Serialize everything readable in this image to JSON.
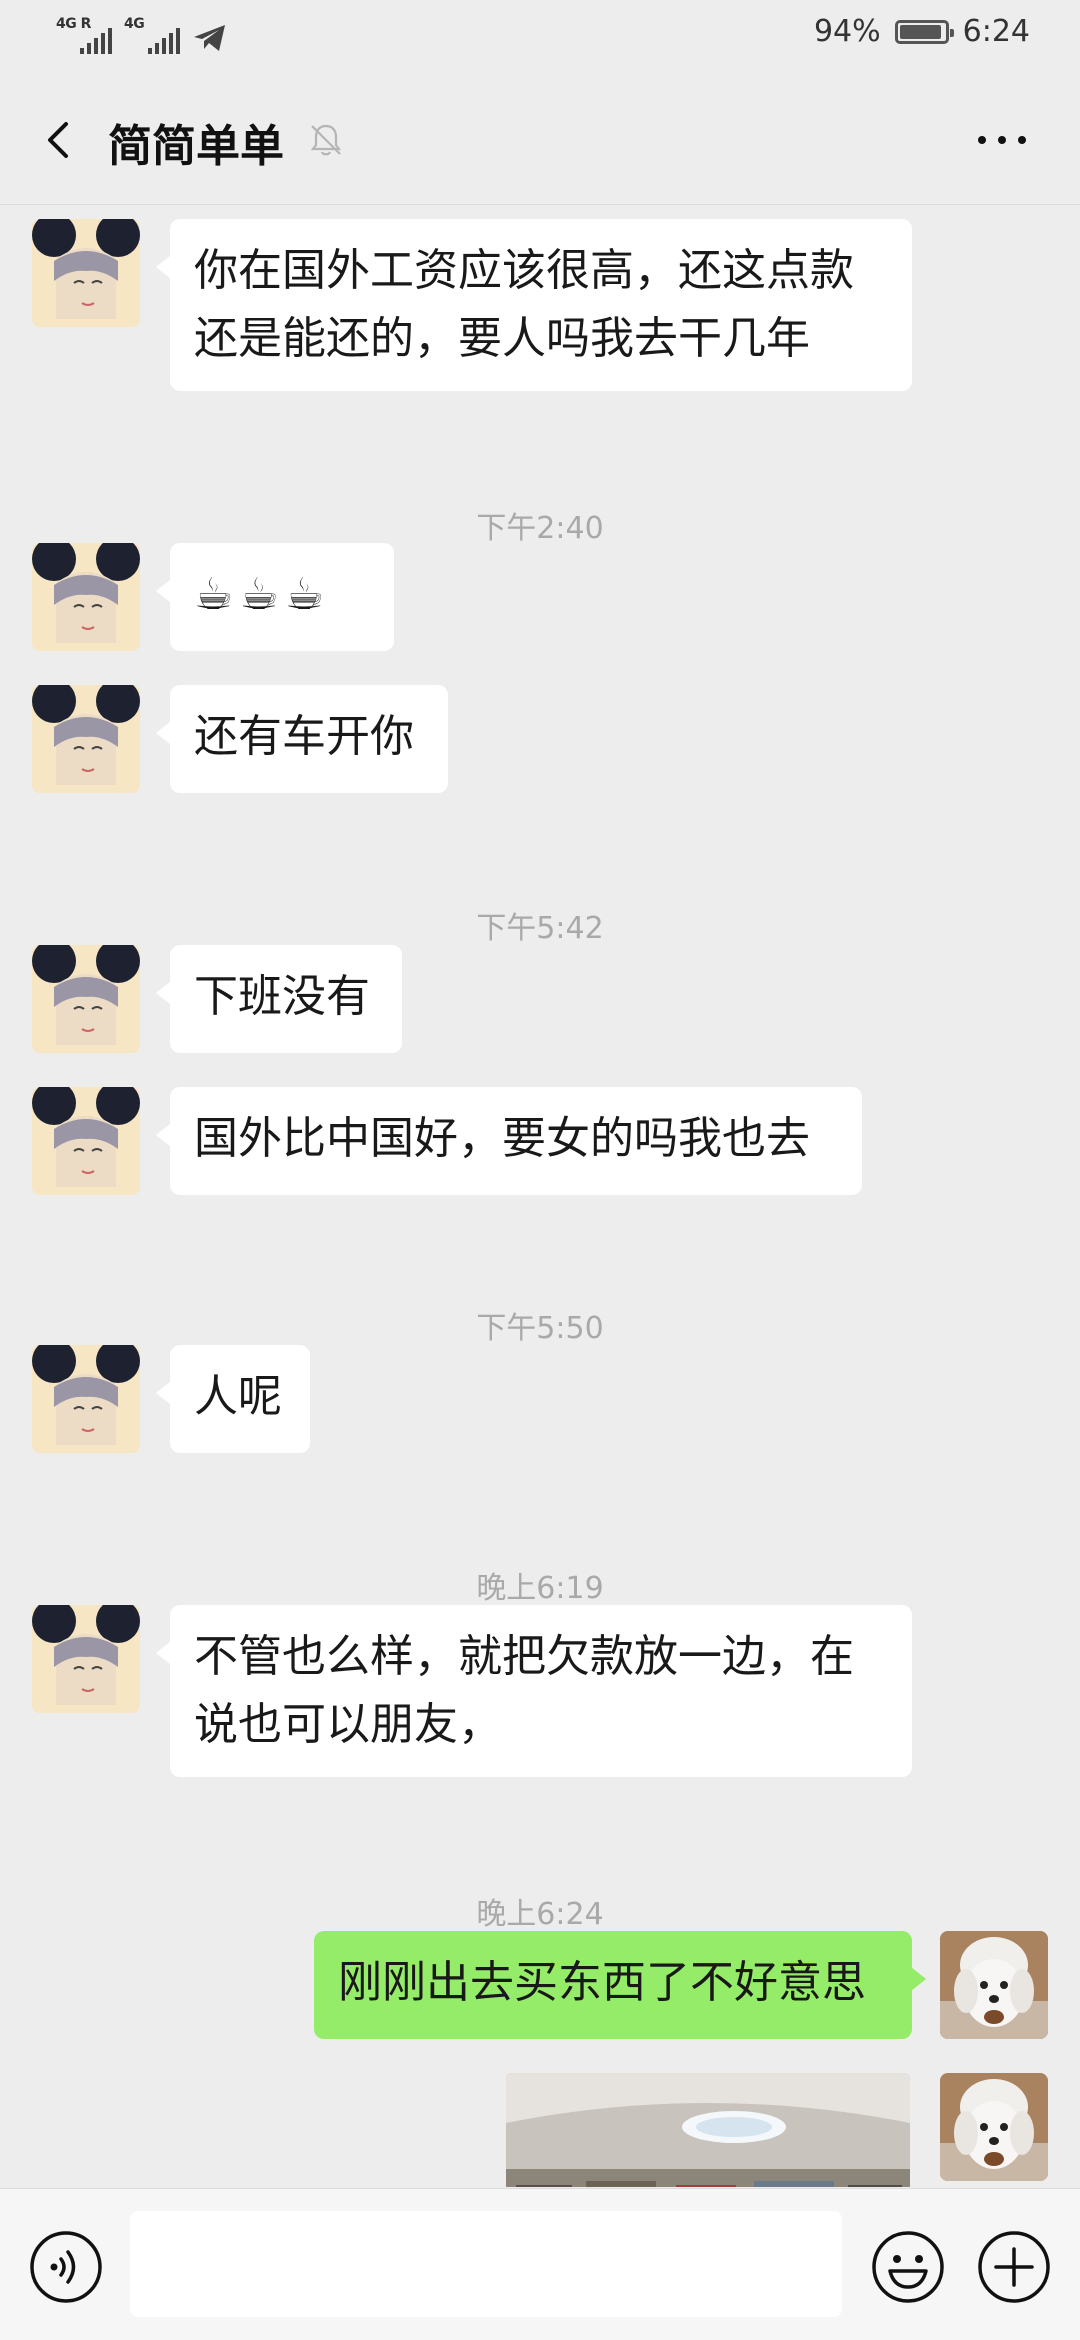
{
  "status_bar": {
    "signal_1_label": "4G R",
    "signal_2_label": "4G",
    "battery_percent": "94%",
    "battery_level": 0.94,
    "time": "6:24"
  },
  "header": {
    "title": "简简单单",
    "icons": [
      "back-icon",
      "mute-bell-icon",
      "more-icon"
    ]
  },
  "messages": [
    {
      "type": "text",
      "direction": "in",
      "lines": [
        "你在国外工资应该很高，还这点款",
        "还是能还的，要人吗我去干几年"
      ]
    },
    {
      "type": "time",
      "text": "下午2:40"
    },
    {
      "type": "emoji",
      "direction": "in",
      "text": "☕☕☕"
    },
    {
      "type": "text",
      "direction": "in",
      "lines": [
        "还有车开你"
      ]
    },
    {
      "type": "time",
      "text": "下午5:42"
    },
    {
      "type": "text",
      "direction": "in",
      "lines": [
        "下班没有"
      ]
    },
    {
      "type": "text",
      "direction": "in",
      "lines": [
        "国外比中国好，要女的吗我也去"
      ]
    },
    {
      "type": "time",
      "text": "下午5:50"
    },
    {
      "type": "text",
      "direction": "in",
      "lines": [
        "人呢"
      ]
    },
    {
      "type": "time",
      "text": "晚上6:19"
    },
    {
      "type": "text",
      "direction": "in",
      "lines": [
        "不管也么样，就把欠款放一边，在",
        "说也可以朋友，"
      ]
    },
    {
      "type": "time",
      "text": "晚上6:24"
    },
    {
      "type": "text",
      "direction": "out",
      "lines": [
        "刚刚出去买东西了不好意思"
      ]
    },
    {
      "type": "image",
      "direction": "out"
    }
  ],
  "input_bar": {
    "value": "",
    "icons": [
      "voice-icon",
      "emoji-icon",
      "plus-icon"
    ]
  },
  "colors": {
    "background": "#ededed",
    "incoming_bubble": "#ffffff",
    "outgoing_bubble": "#95ec69",
    "timestamp_text": "#a9a9a9"
  }
}
